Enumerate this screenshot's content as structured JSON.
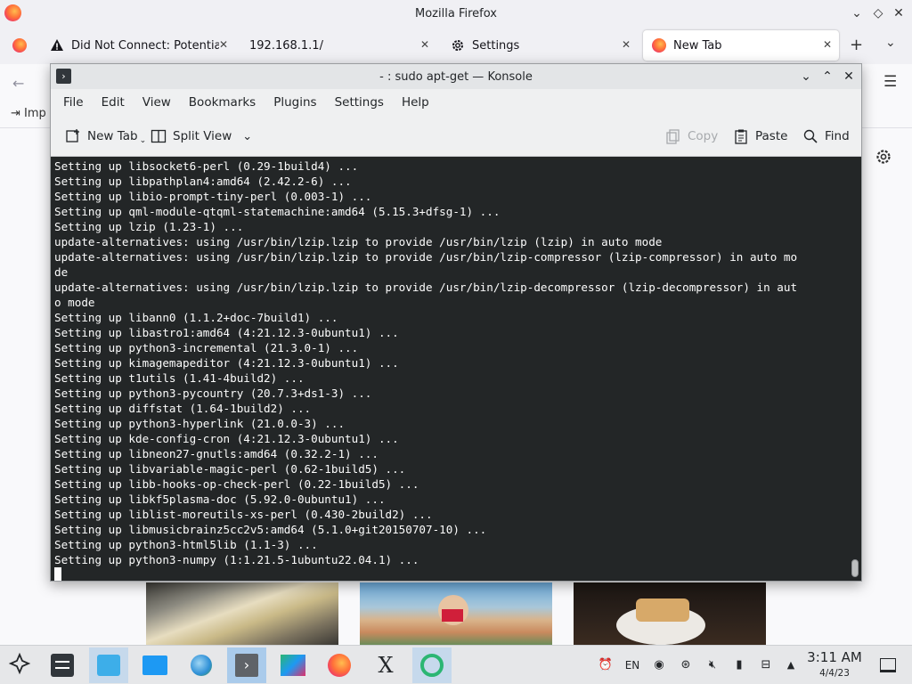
{
  "firefox": {
    "title": "Mozilla Firefox",
    "tabs": [
      {
        "label": "Did Not Connect: Potential"
      },
      {
        "label": "192.168.1.1/"
      },
      {
        "label": "Settings"
      },
      {
        "label": "New Tab"
      }
    ],
    "bookmark_import": "Imp"
  },
  "konsole": {
    "title": "- : sudo apt-get — Konsole",
    "menu": [
      "File",
      "Edit",
      "View",
      "Bookmarks",
      "Plugins",
      "Settings",
      "Help"
    ],
    "toolbar": {
      "new_tab": "New Tab",
      "split_view": "Split View",
      "copy": "Copy",
      "paste": "Paste",
      "find": "Find"
    },
    "terminal_lines": [
      "Setting up libsocket6-perl (0.29-1build4) ...",
      "Setting up libpathplan4:amd64 (2.42.2-6) ...",
      "Setting up libio-prompt-tiny-perl (0.003-1) ...",
      "Setting up qml-module-qtqml-statemachine:amd64 (5.15.3+dfsg-1) ...",
      "Setting up lzip (1.23-1) ...",
      "update-alternatives: using /usr/bin/lzip.lzip to provide /usr/bin/lzip (lzip) in auto mode",
      "update-alternatives: using /usr/bin/lzip.lzip to provide /usr/bin/lzip-compressor (lzip-compressor) in auto mo",
      "de",
      "update-alternatives: using /usr/bin/lzip.lzip to provide /usr/bin/lzip-decompressor (lzip-decompressor) in aut",
      "o mode",
      "Setting up libann0 (1.1.2+doc-7build1) ...",
      "Setting up libastro1:amd64 (4:21.12.3-0ubuntu1) ...",
      "Setting up python3-incremental (21.3.0-1) ...",
      "Setting up kimagemapeditor (4:21.12.3-0ubuntu1) ...",
      "Setting up t1utils (1.41-4build2) ...",
      "Setting up python3-pycountry (20.7.3+ds1-3) ...",
      "Setting up diffstat (1.64-1build2) ...",
      "Setting up python3-hyperlink (21.0.0-3) ...",
      "Setting up kde-config-cron (4:21.12.3-0ubuntu1) ...",
      "Setting up libneon27-gnutls:amd64 (0.32.2-1) ...",
      "Setting up libvariable-magic-perl (0.62-1build5) ...",
      "Setting up libb-hooks-op-check-perl (0.22-1build5) ...",
      "Setting up libkf5plasma-doc (5.92.0-0ubuntu1) ...",
      "Setting up liblist-moreutils-xs-perl (0.430-2build2) ...",
      "Setting up libmusicbrainz5cc2v5:amd64 (5.1.0+git20150707-10) ...",
      "Setting up python3-html5lib (1.1-3) ...",
      "Setting up python3-numpy (1:1.21.5-1ubuntu22.04.1) ..."
    ]
  },
  "taskbar": {
    "language": "EN",
    "time": "3:11 AM",
    "date": "4/4/23"
  },
  "colors": {
    "terminal_bg": "#232627",
    "terminal_fg": "#fcfcfc",
    "taskbar_bg": "#e6e7e9",
    "active_task": "#c6d9ec"
  }
}
